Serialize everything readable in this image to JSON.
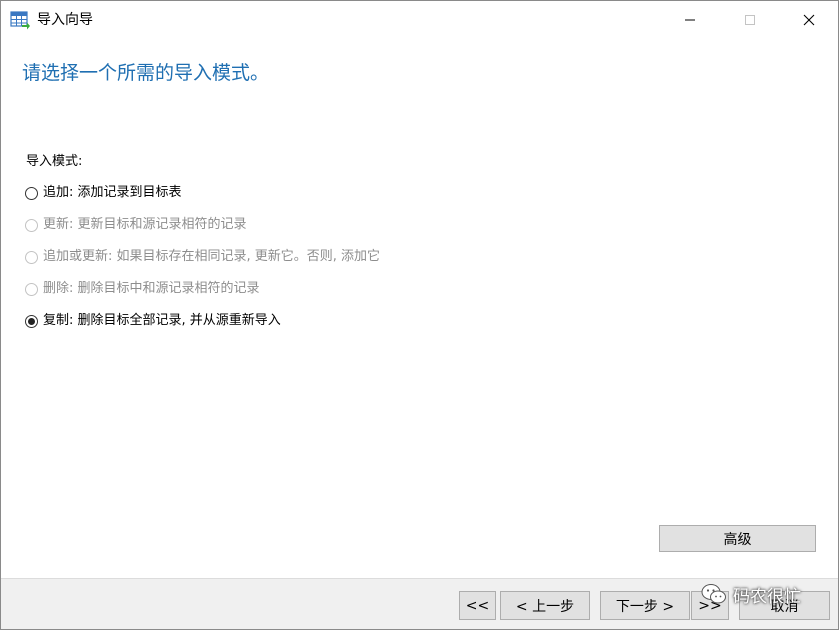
{
  "window": {
    "title": "导入向导",
    "icon": "table-import-icon"
  },
  "heading": "请选择一个所需的导入模式。",
  "mode_group": {
    "label": "导入模式:",
    "options": [
      {
        "label": "追加: 添加记录到目标表",
        "selected": false,
        "enabled": true
      },
      {
        "label": "更新: 更新目标和源记录相符的记录",
        "selected": false,
        "enabled": false
      },
      {
        "label": "追加或更新: 如果目标存在相同记录, 更新它。否则, 添加它",
        "selected": false,
        "enabled": false
      },
      {
        "label": "删除: 删除目标中和源记录相符的记录",
        "selected": false,
        "enabled": false
      },
      {
        "label": "复制: 删除目标全部记录, 并从源重新导入",
        "selected": true,
        "enabled": true
      }
    ]
  },
  "advanced_button": "高级",
  "footer": {
    "first": "<<",
    "prev": "< 上一步",
    "next": "下一步 >",
    "last": ">>",
    "cancel": "取消"
  },
  "watermark": "码农很忙",
  "colors": {
    "heading": "#1f6fb2",
    "footer_bg": "#f0f0f0",
    "button_bg": "#e1e1e1"
  }
}
